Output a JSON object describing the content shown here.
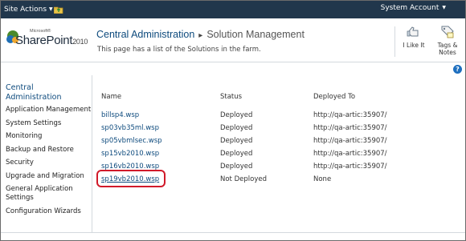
{
  "ribbon": {
    "site_actions_label": "Site Actions",
    "account_label": "System Account",
    "bg_color": "#21374c"
  },
  "title_area": {
    "logo": {
      "ms": "Microsoft®",
      "product": "SharePoint",
      "year": "2010"
    },
    "breadcrumb": {
      "parent": "Central Administration",
      "separator": "▸",
      "current": "Solution Management"
    },
    "description": "This page has a list of the Solutions in the farm.",
    "like_label": "I Like It",
    "tags_label": "Tags &",
    "tags_label2": "Notes"
  },
  "help": {
    "label": "?"
  },
  "leftnav": {
    "heading_line1": "Central",
    "heading_line2": "Administration",
    "items": [
      {
        "label": "Application Management"
      },
      {
        "label": "System Settings"
      },
      {
        "label": "Monitoring"
      },
      {
        "label": "Backup and Restore"
      },
      {
        "label": "Security"
      },
      {
        "label": "Upgrade and Migration"
      },
      {
        "label": "General Application"
      },
      {
        "label": "Configuration Wizards"
      }
    ],
    "item_wrap": "Settings"
  },
  "table": {
    "headers": {
      "name": "Name",
      "status": "Status",
      "deployed_to": "Deployed To"
    },
    "rows": [
      {
        "name": "billsp4.wsp",
        "status": "Deployed",
        "deployed_to": "http://qa-artic:35907/"
      },
      {
        "name": "sp03vb35ml.wsp",
        "status": "Deployed",
        "deployed_to": "http://qa-artic:35907/"
      },
      {
        "name": "sp05vbmlsec.wsp",
        "status": "Deployed",
        "deployed_to": "http://qa-artic:35907/"
      },
      {
        "name": "sp15vb2010.wsp",
        "status": "Deployed",
        "deployed_to": "http://qa-artic:35907/"
      },
      {
        "name": "sp16vb2010.wsp",
        "status": "Deployed",
        "deployed_to": "http://qa-artic:35907/"
      },
      {
        "name": "sp19vb2010.wsp",
        "status": "Not Deployed",
        "deployed_to": "None"
      }
    ],
    "highlight_color": "#d11a2a"
  }
}
